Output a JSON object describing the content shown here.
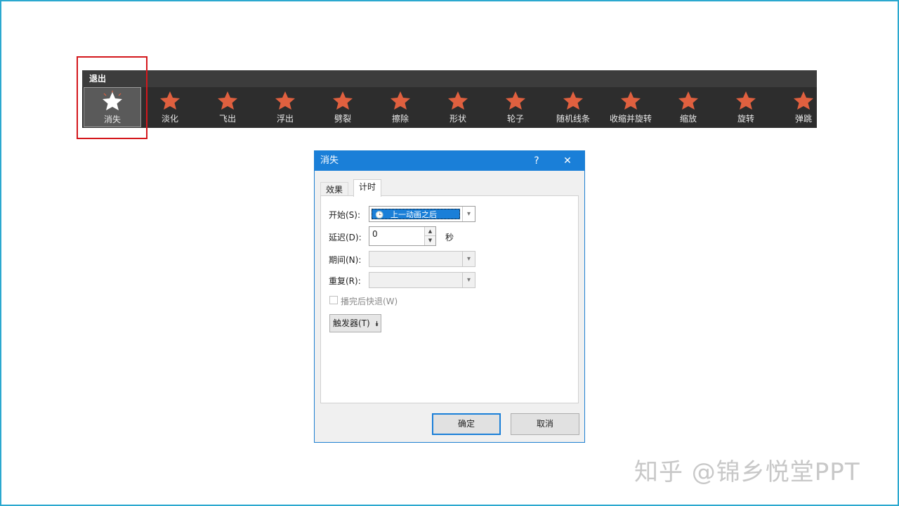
{
  "gallery": {
    "header": "退出",
    "accent_color": "#e0603f",
    "items": [
      {
        "label": "消失",
        "icon": "star-fade-icon",
        "selected": true
      },
      {
        "label": "淡化",
        "icon": "star-icon"
      },
      {
        "label": "飞出",
        "icon": "star-fly-out-icon"
      },
      {
        "label": "浮出",
        "icon": "star-float-icon"
      },
      {
        "label": "劈裂",
        "icon": "star-split-icon"
      },
      {
        "label": "擦除",
        "icon": "star-wipe-icon"
      },
      {
        "label": "形状",
        "icon": "star-shape-icon"
      },
      {
        "label": "轮子",
        "icon": "star-wheel-icon"
      },
      {
        "label": "随机线条",
        "icon": "star-lines-icon"
      },
      {
        "label": "收缩并旋转",
        "icon": "star-shrink-turn-icon"
      },
      {
        "label": "缩放",
        "icon": "star-zoom-icon"
      },
      {
        "label": "旋转",
        "icon": "star-swivel-icon"
      },
      {
        "label": "弹跳",
        "icon": "star-bounce-icon"
      }
    ]
  },
  "dialog": {
    "title": "消失",
    "help": "?",
    "close": "✕",
    "tabs": [
      {
        "label": "效果",
        "active": false
      },
      {
        "label": "计时",
        "active": true
      }
    ],
    "start_label": "开始(S):",
    "start_value": "上一动画之后",
    "delay_label": "延迟(D):",
    "delay_value": "0",
    "delay_unit": "秒",
    "duration_label": "期间(N):",
    "repeat_label": "重复(R):",
    "rewind_label": "播完后快退(W)",
    "trigger_label": "触发器(T)",
    "ok_label": "确定",
    "cancel_label": "取消"
  },
  "watermark": "知乎 @锦乡悦堂PPT"
}
